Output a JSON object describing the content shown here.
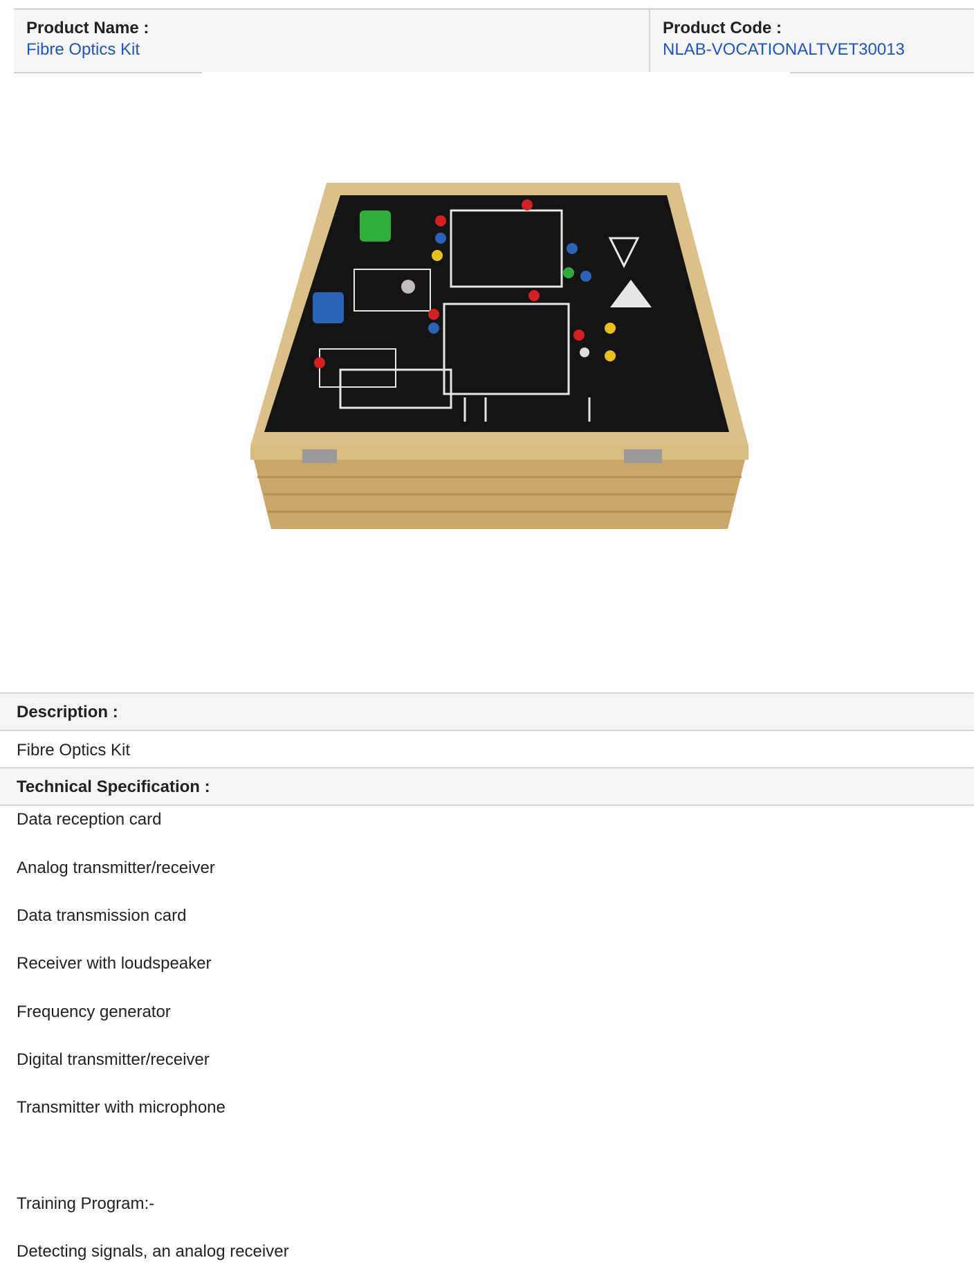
{
  "header": {
    "product_name_label": "Product Name :",
    "product_name_value": "Fibre Optics Kit",
    "product_code_label": "Product Code :",
    "product_code_value": "NLAB-VOCATIONALTVET30013"
  },
  "description": {
    "label": "Description :",
    "text": "Fibre Optics Kit"
  },
  "technical_specification": {
    "label": "Technical Specification :",
    "items": [
      "Data reception card",
      "Analog transmitter/receiver",
      "Data transmission card",
      "Receiver with loudspeaker",
      "Frequency generator",
      "Digital transmitter/receiver",
      "Transmitter with microphone",
      "",
      "Training Program:-",
      "Detecting signals, an analog receiver"
    ]
  },
  "colors": {
    "link": "#1a56c9",
    "header_bg": "#f6f6f6",
    "border": "#d6d6d6"
  }
}
